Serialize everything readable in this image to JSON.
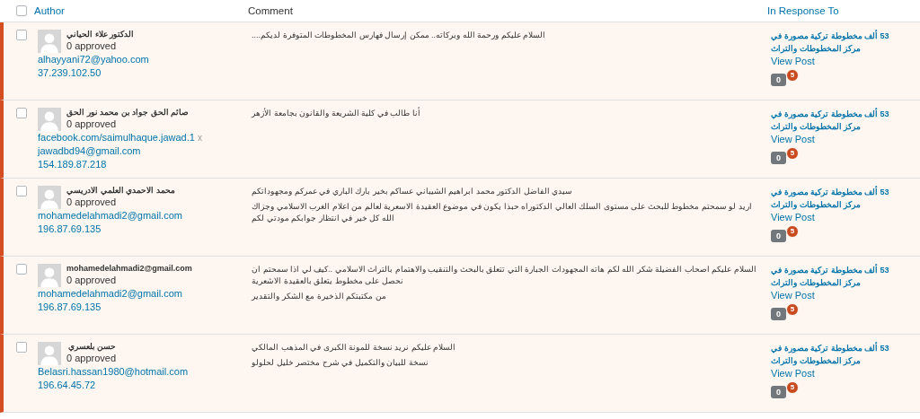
{
  "table": {
    "header": {
      "author": "Author",
      "comment": "Comment",
      "in_response_to": "In Response To"
    },
    "select_all": {
      "checked": false
    },
    "rows": [
      {
        "checked": false,
        "unapproved": true,
        "author": "الدكتور علاء الحياني",
        "approved": "0 approved",
        "links": [
          {
            "text": "alhayyani72@yahoo.com"
          },
          {
            "text": "37.239.102.50"
          }
        ],
        "comment": [
          "السلام عليكم ورحمة الله وبركاته.. ممكن إرسال فهارس المخطوطات المتوفرة لديكم...."
        ],
        "post": "53 ألف مخطوطة تركية مصورة في مركز المخطوطات والتراث",
        "view": "View Post",
        "approved_count": "0",
        "pending_count": "5"
      },
      {
        "checked": false,
        "unapproved": true,
        "author": "صائم الحق جواد بن محمد نور الحق",
        "approved": "0 approved",
        "links": [
          {
            "text": "facebook.com/saimulhaque.jawad.1",
            "extra": "x"
          },
          {
            "text": "jawadbd94@gmail.com"
          },
          {
            "text": "154.189.87.218"
          }
        ],
        "comment": [
          "أنا طالب في كلية الشريعة والقانون بجامعة الأزهر"
        ],
        "post": "53 ألف مخطوطة تركية مصورة في مركز المخطوطات والتراث",
        "view": "View Post",
        "approved_count": "0",
        "pending_count": "5"
      },
      {
        "checked": false,
        "unapproved": true,
        "author": "محمد الاحمدي العلمي الادريسي",
        "approved": "0 approved",
        "links": [
          {
            "text": "mohamedelahmadi2@gmail.com"
          },
          {
            "text": "196.87.69.135"
          }
        ],
        "comment": [
          "سيدي الفاضل الدكتور محمد ابراهيم الشيباني عساكم بخير بارك الباري في عمركم ومجهوداتكم",
          "اريد لو سمحتم مخطوط للبحث على مستوى السلك العالي الدكتوراه حبذا يكون في موضوع العقيدة الاسعرية لعالم من اعلام الغرب الاسلامي وجزاك الله كل خير في انتظار جوابكم مودتي لكم"
        ],
        "post": "53 ألف مخطوطة تركية مصورة في مركز المخطوطات والتراث",
        "view": "View Post",
        "approved_count": "0",
        "pending_count": "5"
      },
      {
        "checked": false,
        "unapproved": true,
        "author": "mohamedelahmadi2@gmail.com",
        "approved": "0 approved",
        "links": [
          {
            "text": "mohamedelahmadi2@gmail.com"
          },
          {
            "text": "196.87.69.135"
          }
        ],
        "comment": [
          "السلام عليكم اصحاب الفضيلة شكر الله لكم هاته المجهودات الجبارة التي تتعلق بالبحث والتنقيب والاهتمام بالتراث الاسلامي ..كيف لي اذا سمحتم ان نحصل على مخطوط يتعلق بالعقيدة الاشعرية",
          "من مكتبتكم الذخيرة مع الشكر والتقدير"
        ],
        "post": "53 ألف مخطوطة تركية مصورة في مركز المخطوطات والتراث",
        "view": "View Post",
        "approved_count": "0",
        "pending_count": "5"
      },
      {
        "checked": false,
        "unapproved": true,
        "author": "حسن بلعسري",
        "approved": "0 approved",
        "links": [
          {
            "text": "Belasri.hassan1980@hotmail.com"
          },
          {
            "text": "196.64.45.72"
          }
        ],
        "comment": [
          "السلام عليكم نريد نسخة للمونة الكبرى في المذهب المالكي",
          "نسخة للبيان والتكميل في شرح مختصر خليل لحلولو"
        ],
        "post": "53 ألف مخطوطة تركية مصورة في مركز المخطوطات والتراث",
        "view": "View Post",
        "approved_count": "0",
        "pending_count": "5"
      }
    ]
  }
}
